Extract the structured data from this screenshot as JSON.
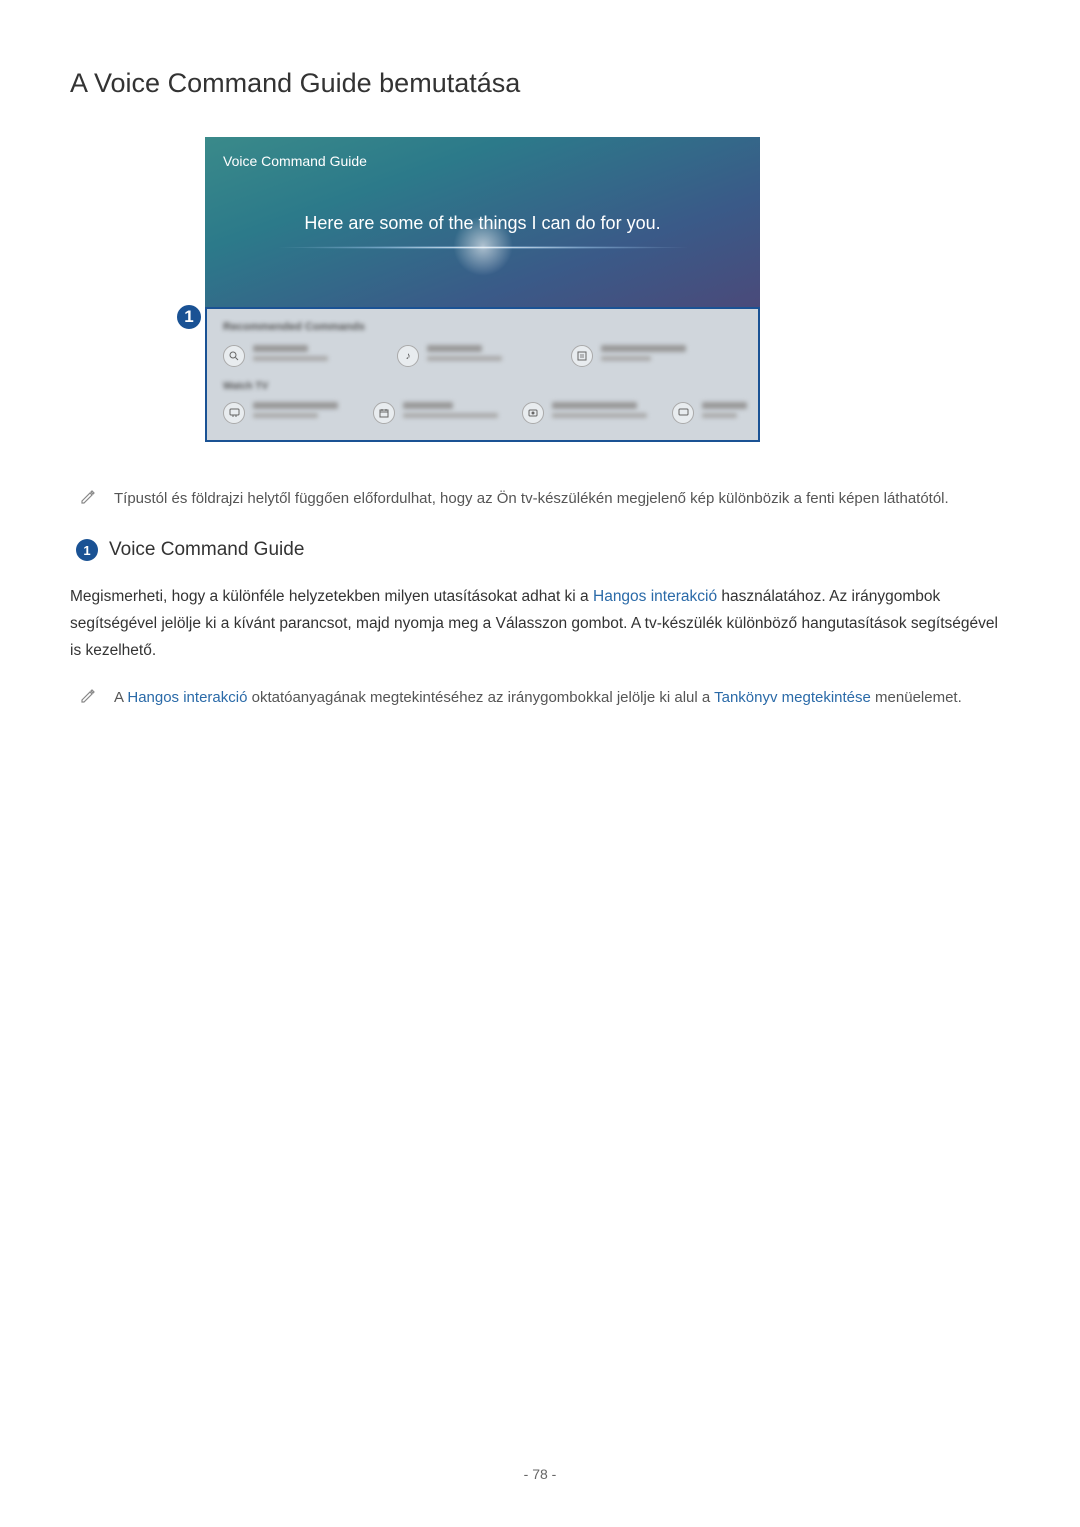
{
  "title": "A Voice Command Guide bemutatása",
  "screenshot": {
    "guide_title": "Voice Command Guide",
    "intro_message": "Here are some of the things I can do for you."
  },
  "marker1": "1",
  "note1": "Típustól és földrajzi helytől függően előfordulhat, hogy az Ön tv-készülékén megjelenő kép különbözik a fenti képen láthatótól.",
  "section": {
    "badge": "1",
    "title": "Voice Command Guide"
  },
  "body_p1_a": "Megismerheti, hogy a különféle helyzetekben milyen utasításokat adhat ki a ",
  "body_p1_link1": "Hangos interakció",
  "body_p1_b": " használatához. Az iránygombok segítségével jelölje ki a kívánt parancsot, majd nyomja meg a Válasszon gombot. A tv-készülék különböző hangutasítások segítségével is kezelhető.",
  "note2": {
    "a": "A ",
    "link1": "Hangos interakció",
    "b": " oktatóanyagának megtekintéséhez az iránygombokkal jelölje ki alul a ",
    "link2": "Tankönyv megtekintése",
    "c": " menüelemet."
  },
  "page_number": "- 78 -"
}
